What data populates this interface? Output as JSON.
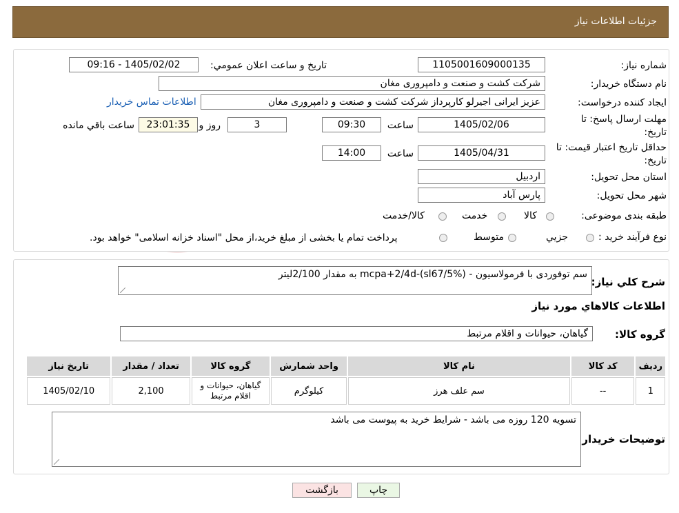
{
  "header": {
    "title": "جزئیات اطلاعات نیاز"
  },
  "watermark": {
    "text": "AriaTender.neT"
  },
  "info": {
    "need_number_label": "شماره نیاز:",
    "need_number": "1105001609000135",
    "announce_label": "تاريخ و ساعت اعلان عمومي:",
    "announce_value": "1405/02/02 - 09:16",
    "buyer_org_label": "نام دستگاه خريدار:",
    "buyer_org": "شركت كشت و صنعت و دامپروری مغان",
    "requester_label": "ايجاد کننده درخواست:",
    "requester": "عزیز ایرانی اجیرلو کارپرداز شرکت کشت و صنعت و دامپروری مغان",
    "contact_link": "اطلاعات تماس خريدار",
    "deadline_label_1": "مهلت ارسال پاسخ: تا",
    "deadline_label_2": "تاريخ:",
    "deadline_date": "1405/02/06",
    "time_label": "ساعت",
    "deadline_time": "09:30",
    "days_value": "3",
    "days_label": "روز و",
    "remaining_time": "23:01:35",
    "remaining_label": "ساعت باقي مانده",
    "validity_label_1": "حداقل تاريخ اعتبار قيمت: تا",
    "validity_label_2": "تاريخ:",
    "validity_date": "1405/04/31",
    "validity_time": "14:00",
    "province_label": "استان محل تحويل:",
    "province": "اردبیل",
    "city_label": "شهر محل تحويل:",
    "city": "پارس آباد",
    "category_label": "طبقه بندی موضوعی:",
    "category_options": [
      "كالا",
      "خدمت",
      "كالا/خدمت"
    ],
    "process_label": "نوع فرآيند خريد :",
    "process_options": [
      "جزيي",
      "متوسط"
    ],
    "process_note": "پرداخت تمام يا بخشی از مبلغ خريد،از محل \"اسناد خزانه اسلامی\" خواهد بود."
  },
  "details": {
    "summary_label": "شرح كلي نياز:",
    "summary": "سم توفوردی با فرمولاسیون - mcpa+2/4d-(sl67/5%) به مقدار 2/100لیتر",
    "goods_info_title": "اطلاعات كالاهاي مورد نياز",
    "goods_group_label": "گروه كالا:",
    "goods_group": "گیاهان، حیوانات و اقلام مرتبط"
  },
  "table": {
    "headers": [
      "رديف",
      "كد كالا",
      "نام كالا",
      "واحد شمارش",
      "گروه كالا",
      "تعداد / مقدار",
      "تاريخ نياز"
    ],
    "rows": [
      [
        "1",
        "--",
        "سم علف هرز",
        "كيلوگرم",
        "گیاهان، حیوانات و اقلام مرتبط",
        "2,100",
        "1405/02/10"
      ]
    ]
  },
  "buyer_notes": {
    "label": "توضيحات خريدار:",
    "text": "تسویه 120 روزه می باشد - شرایط خرید به پیوست می باشد"
  },
  "buttons": {
    "print": "چاپ",
    "back": "بازگشت"
  },
  "colors": {
    "header": "#8b6a3d",
    "print_btn": "#eaf7e4",
    "back_btn": "#fbe3e3"
  }
}
